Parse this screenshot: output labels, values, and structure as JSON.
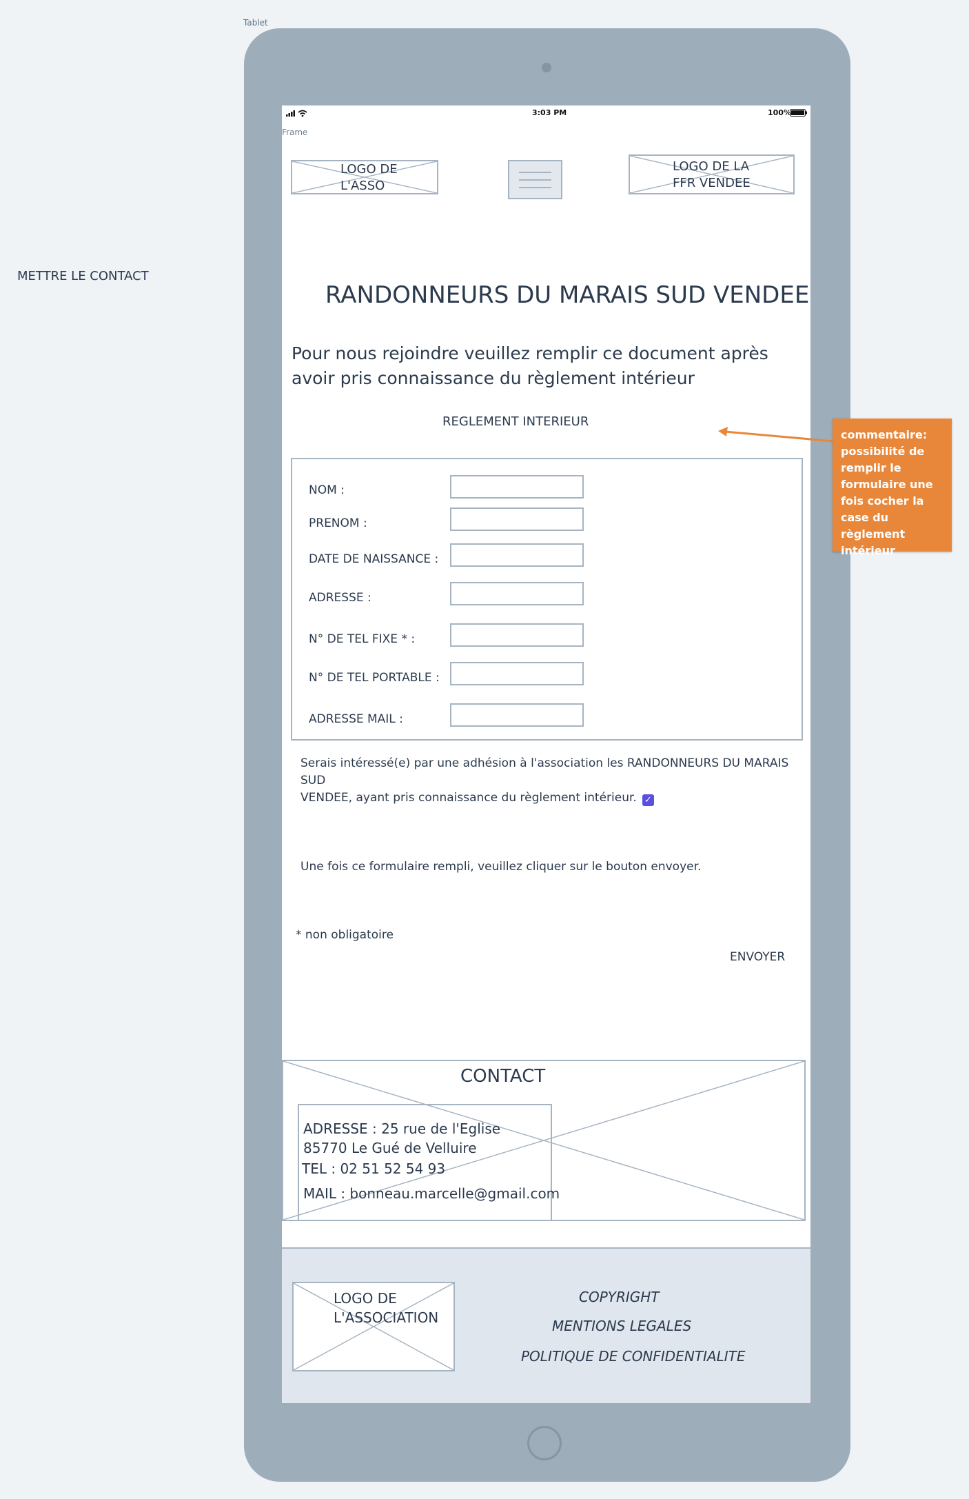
{
  "canvas": {
    "tablet_label": "Tablet",
    "side_note": "METTRE LE CONTACT"
  },
  "statusbar": {
    "time": "3:03 PM",
    "battery": "100%"
  },
  "frame_label": "Frame",
  "header": {
    "logo_asso": "LOGO DE L'ASSO",
    "logo_ffr": "LOGO DE LA FFR VENDEE"
  },
  "main": {
    "title": "RANDONNEURS DU MARAIS SUD VENDEE",
    "intro_line1": "Pour nous rejoindre veuillez remplir ce document après",
    "intro_line2": "avoir pris connaissance du règlement intérieur",
    "reglement_link": "REGLEMENT INTERIEUR"
  },
  "form": {
    "fields": [
      {
        "label": "NOM :",
        "value": ""
      },
      {
        "label": "PRENOM :",
        "value": ""
      },
      {
        "label": "DATE DE NAISSANCE :",
        "value": ""
      },
      {
        "label": "ADRESSE :",
        "value": ""
      },
      {
        "label": "N° DE TEL FIXE * :",
        "value": ""
      },
      {
        "label": "N° DE TEL PORTABLE :",
        "value": ""
      },
      {
        "label": "ADRESSE MAIL :",
        "value": ""
      }
    ],
    "consent_line1": "Serais intéressé(e) par une adhésion à l'association les RANDONNEURS DU MARAIS SUD",
    "consent_line2": "VENDEE, ayant pris connaissance du règlement intérieur.",
    "consent_checked": true,
    "instruction": "Une fois ce formulaire rempli, veuillez cliquer sur le bouton envoyer.",
    "optional_note": "* non obligatoire",
    "submit_label": "ENVOYER"
  },
  "contact": {
    "title": "CONTACT",
    "address_line1": "ADRESSE :  25 rue de l'Eglise",
    "address_line2": "85770 Le Gué de Velluire",
    "phone": "TEL : 02 51 52 54 93",
    "mail": "MAIL : bonneau.marcelle@gmail.com"
  },
  "footer": {
    "logo": "LOGO DE L'ASSOCIATION",
    "links": [
      "COPYRIGHT",
      "MENTIONS LEGALES",
      "POLITIQUE DE CONFIDENTIALITE"
    ]
  },
  "comment": {
    "text": "commentaire: possibilité de remplir le formulaire une fois cocher la  case du règlement intérieur",
    "color": "#e8873a"
  }
}
